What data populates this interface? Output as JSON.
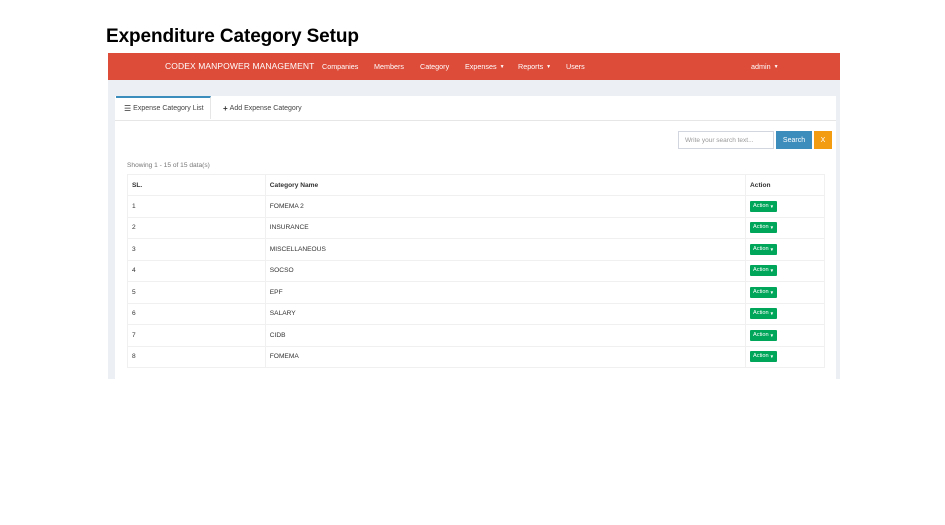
{
  "page": {
    "title": "Expenditure Category Setup"
  },
  "navbar": {
    "brand": "CODEX MANPOWER MANAGEMENT",
    "items": [
      {
        "label": "Companies"
      },
      {
        "label": "Members"
      },
      {
        "label": "Category"
      },
      {
        "label": "Expenses"
      },
      {
        "label": "Reports"
      },
      {
        "label": "Users"
      }
    ],
    "user": "admin",
    "color": "#dd4b39"
  },
  "tabs": {
    "list_label": "Expense Category List",
    "add_label": "Add Expense Category"
  },
  "search": {
    "placeholder": "Write your search text...",
    "button": "Search",
    "clear": "X"
  },
  "showing": "Showing 1 - 15 of 15 data(s)",
  "table": {
    "headers": {
      "sl": "SL.",
      "name": "Category Name",
      "action": "Action"
    },
    "action_label": "Action",
    "rows": [
      {
        "sl": "1",
        "name": "FOMEMA 2"
      },
      {
        "sl": "2",
        "name": "INSURANCE"
      },
      {
        "sl": "3",
        "name": "MISCELLANEOUS"
      },
      {
        "sl": "4",
        "name": "SOCSO"
      },
      {
        "sl": "5",
        "name": "EPF"
      },
      {
        "sl": "6",
        "name": "SALARY"
      },
      {
        "sl": "7",
        "name": "CIDB"
      },
      {
        "sl": "8",
        "name": "FOMEMA"
      }
    ]
  }
}
